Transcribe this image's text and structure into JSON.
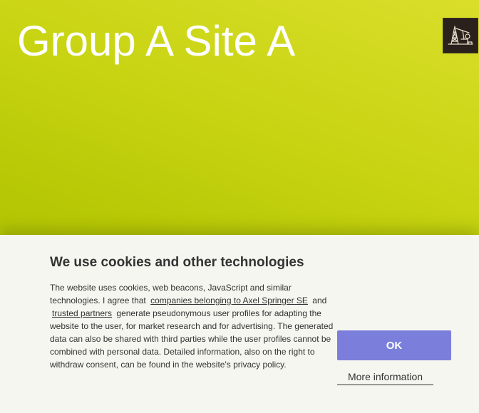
{
  "header": {
    "title": "Group A Site A",
    "logo_icon": "pump-jack-icon"
  },
  "cookie_banner": {
    "title": "We use cookies and other technologies",
    "text_part1": "The website uses cookies, web beacons, JavaScript and similar technologies. I agree that",
    "link_companies": "companies belonging to Axel Springer SE",
    "text_and": "and",
    "link_partners": "trusted partners",
    "text_part2": "generate pseudonymous user profiles for adapting the website to the user, for market research and for advertising. The generated data can also be shared with third parties while the user profiles cannot be combined with personal data. Detailed information, also on the right to withdraw consent, can be found in the website's privacy policy.",
    "ok_label": "OK",
    "more_info_label": "More information"
  },
  "colors": {
    "hero_accent": "#c8d412",
    "banner_background": "#f5f6ef",
    "ok_button": "#7b7fdb",
    "text": "#333333"
  }
}
